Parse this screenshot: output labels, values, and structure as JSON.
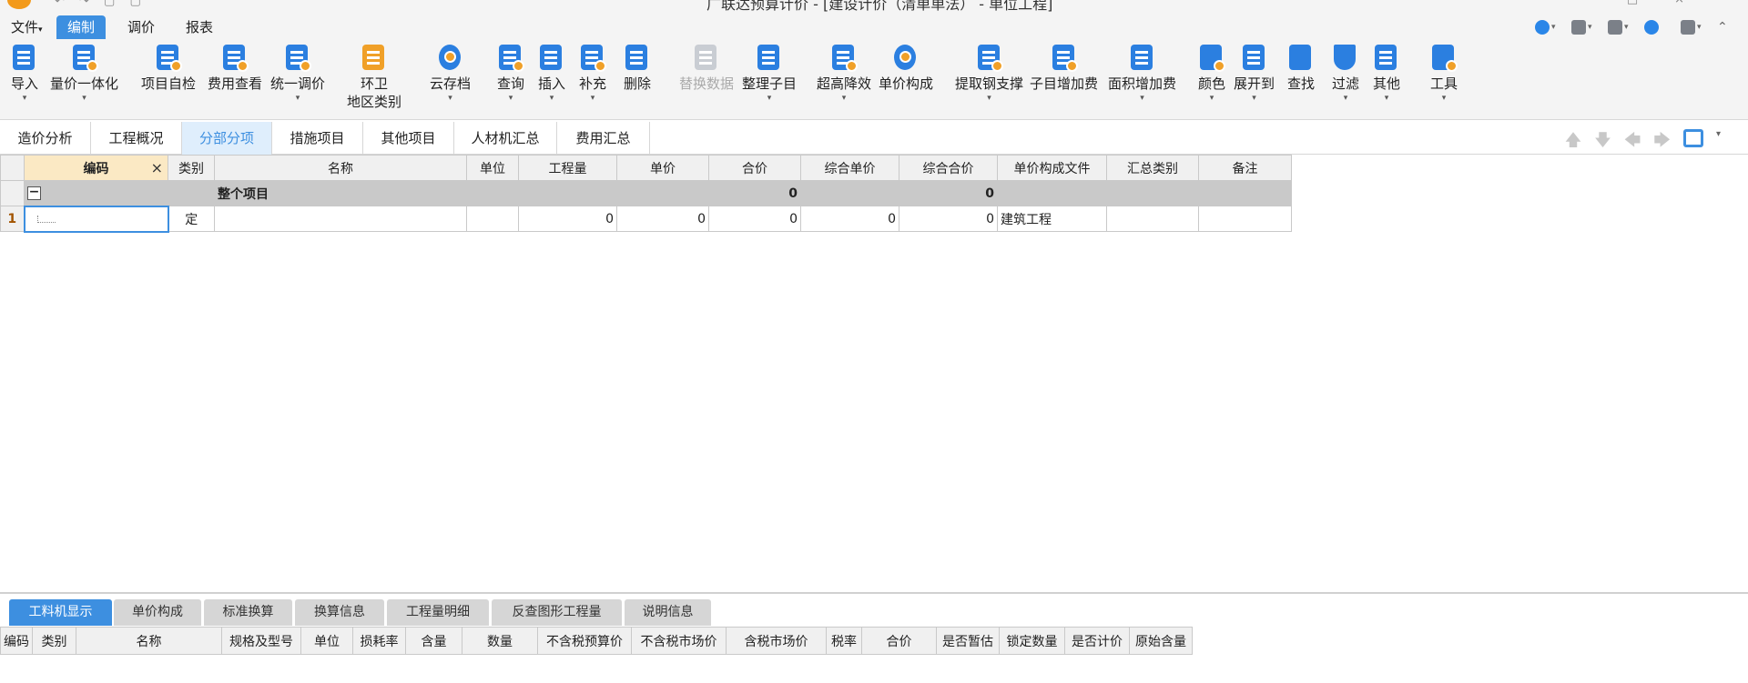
{
  "window": {
    "title": "广联达预算计价 - [建设计价（清单单法） - 单位工程]"
  },
  "menu": {
    "items": [
      {
        "label": "文件",
        "dropdown": "▾"
      },
      {
        "label": "编制",
        "active": true
      },
      {
        "label": "调价"
      },
      {
        "label": "报表"
      }
    ]
  },
  "toolbar": {
    "tools": [
      {
        "label": "导入",
        "dropdown": true
      },
      {
        "label": "量价一体化",
        "dropdown": true
      },
      {
        "label": "项目自检"
      },
      {
        "label": "费用查看"
      },
      {
        "label": "统一调价",
        "dropdown": true
      },
      {
        "label": "环卫",
        "label2": "地区类别"
      },
      {
        "label": "云存档",
        "dropdown": true
      },
      {
        "label": "查询",
        "dropdown": true
      },
      {
        "label": "插入",
        "dropdown": true
      },
      {
        "label": "补充",
        "dropdown": true
      },
      {
        "label": "删除"
      },
      {
        "label": "替换数据",
        "disabled": true
      },
      {
        "label": "整理子目",
        "dropdown": true
      },
      {
        "label": "超高降效",
        "dropdown": true
      },
      {
        "label": "单价构成"
      },
      {
        "label": "提取钢支撑",
        "dropdown": true
      },
      {
        "label": "子目增加费"
      },
      {
        "label": "面积增加费",
        "dropdown": true
      },
      {
        "label": "颜色",
        "dropdown": true
      },
      {
        "label": "展开到",
        "dropdown": true
      },
      {
        "label": "查找"
      },
      {
        "label": "过滤",
        "dropdown": true
      },
      {
        "label": "其他",
        "dropdown": true
      },
      {
        "label": "工具",
        "dropdown": true
      }
    ],
    "dropdown_glyph": "▾"
  },
  "view_tabs": [
    {
      "label": "造价分析"
    },
    {
      "label": "工程概况"
    },
    {
      "label": "分部分项",
      "active": true
    },
    {
      "label": "措施项目"
    },
    {
      "label": "其他项目"
    },
    {
      "label": "人材机汇总"
    },
    {
      "label": "费用汇总"
    }
  ],
  "nav_arrows": {
    "up": "🡅",
    "down": "🡇",
    "left": "🡄",
    "right": "🡆",
    "settings_dropdown": "▾"
  },
  "grid": {
    "columns": [
      "编码",
      "类别",
      "名称",
      "单位",
      "工程量",
      "单价",
      "合价",
      "综合单价",
      "综合合价",
      "单价构成文件",
      "汇总类别",
      "备注"
    ],
    "close_glyph": "×",
    "group_row": {
      "expander": "−",
      "name": "整个项目",
      "total_price": "0",
      "comprehensive_total": "0"
    },
    "rows": [
      {
        "row_no": "1",
        "code": "",
        "type": "定",
        "name": "",
        "unit": "",
        "quantity": "0",
        "unit_price": "0",
        "total_price": "0",
        "comprehensive_unit_price": "0",
        "comprehensive_total": "0",
        "price_file": "建筑工程",
        "summary_category": "",
        "remark": ""
      }
    ]
  },
  "bottom_tabs": [
    {
      "label": "工料机显示",
      "active": true
    },
    {
      "label": "单价构成"
    },
    {
      "label": "标准换算"
    },
    {
      "label": "换算信息"
    },
    {
      "label": "工程量明细"
    },
    {
      "label": "反查图形工程量"
    },
    {
      "label": "说明信息"
    }
  ],
  "bottom_grid": {
    "columns": [
      "编码",
      "类别",
      "名称",
      "规格及型号",
      "单位",
      "损耗率",
      "含量",
      "数量",
      "不含税预算价",
      "不含税市场价",
      "含税市场价",
      "税率",
      "合价",
      "是否暂估",
      "锁定数量",
      "是否计价",
      "原始含量"
    ]
  }
}
